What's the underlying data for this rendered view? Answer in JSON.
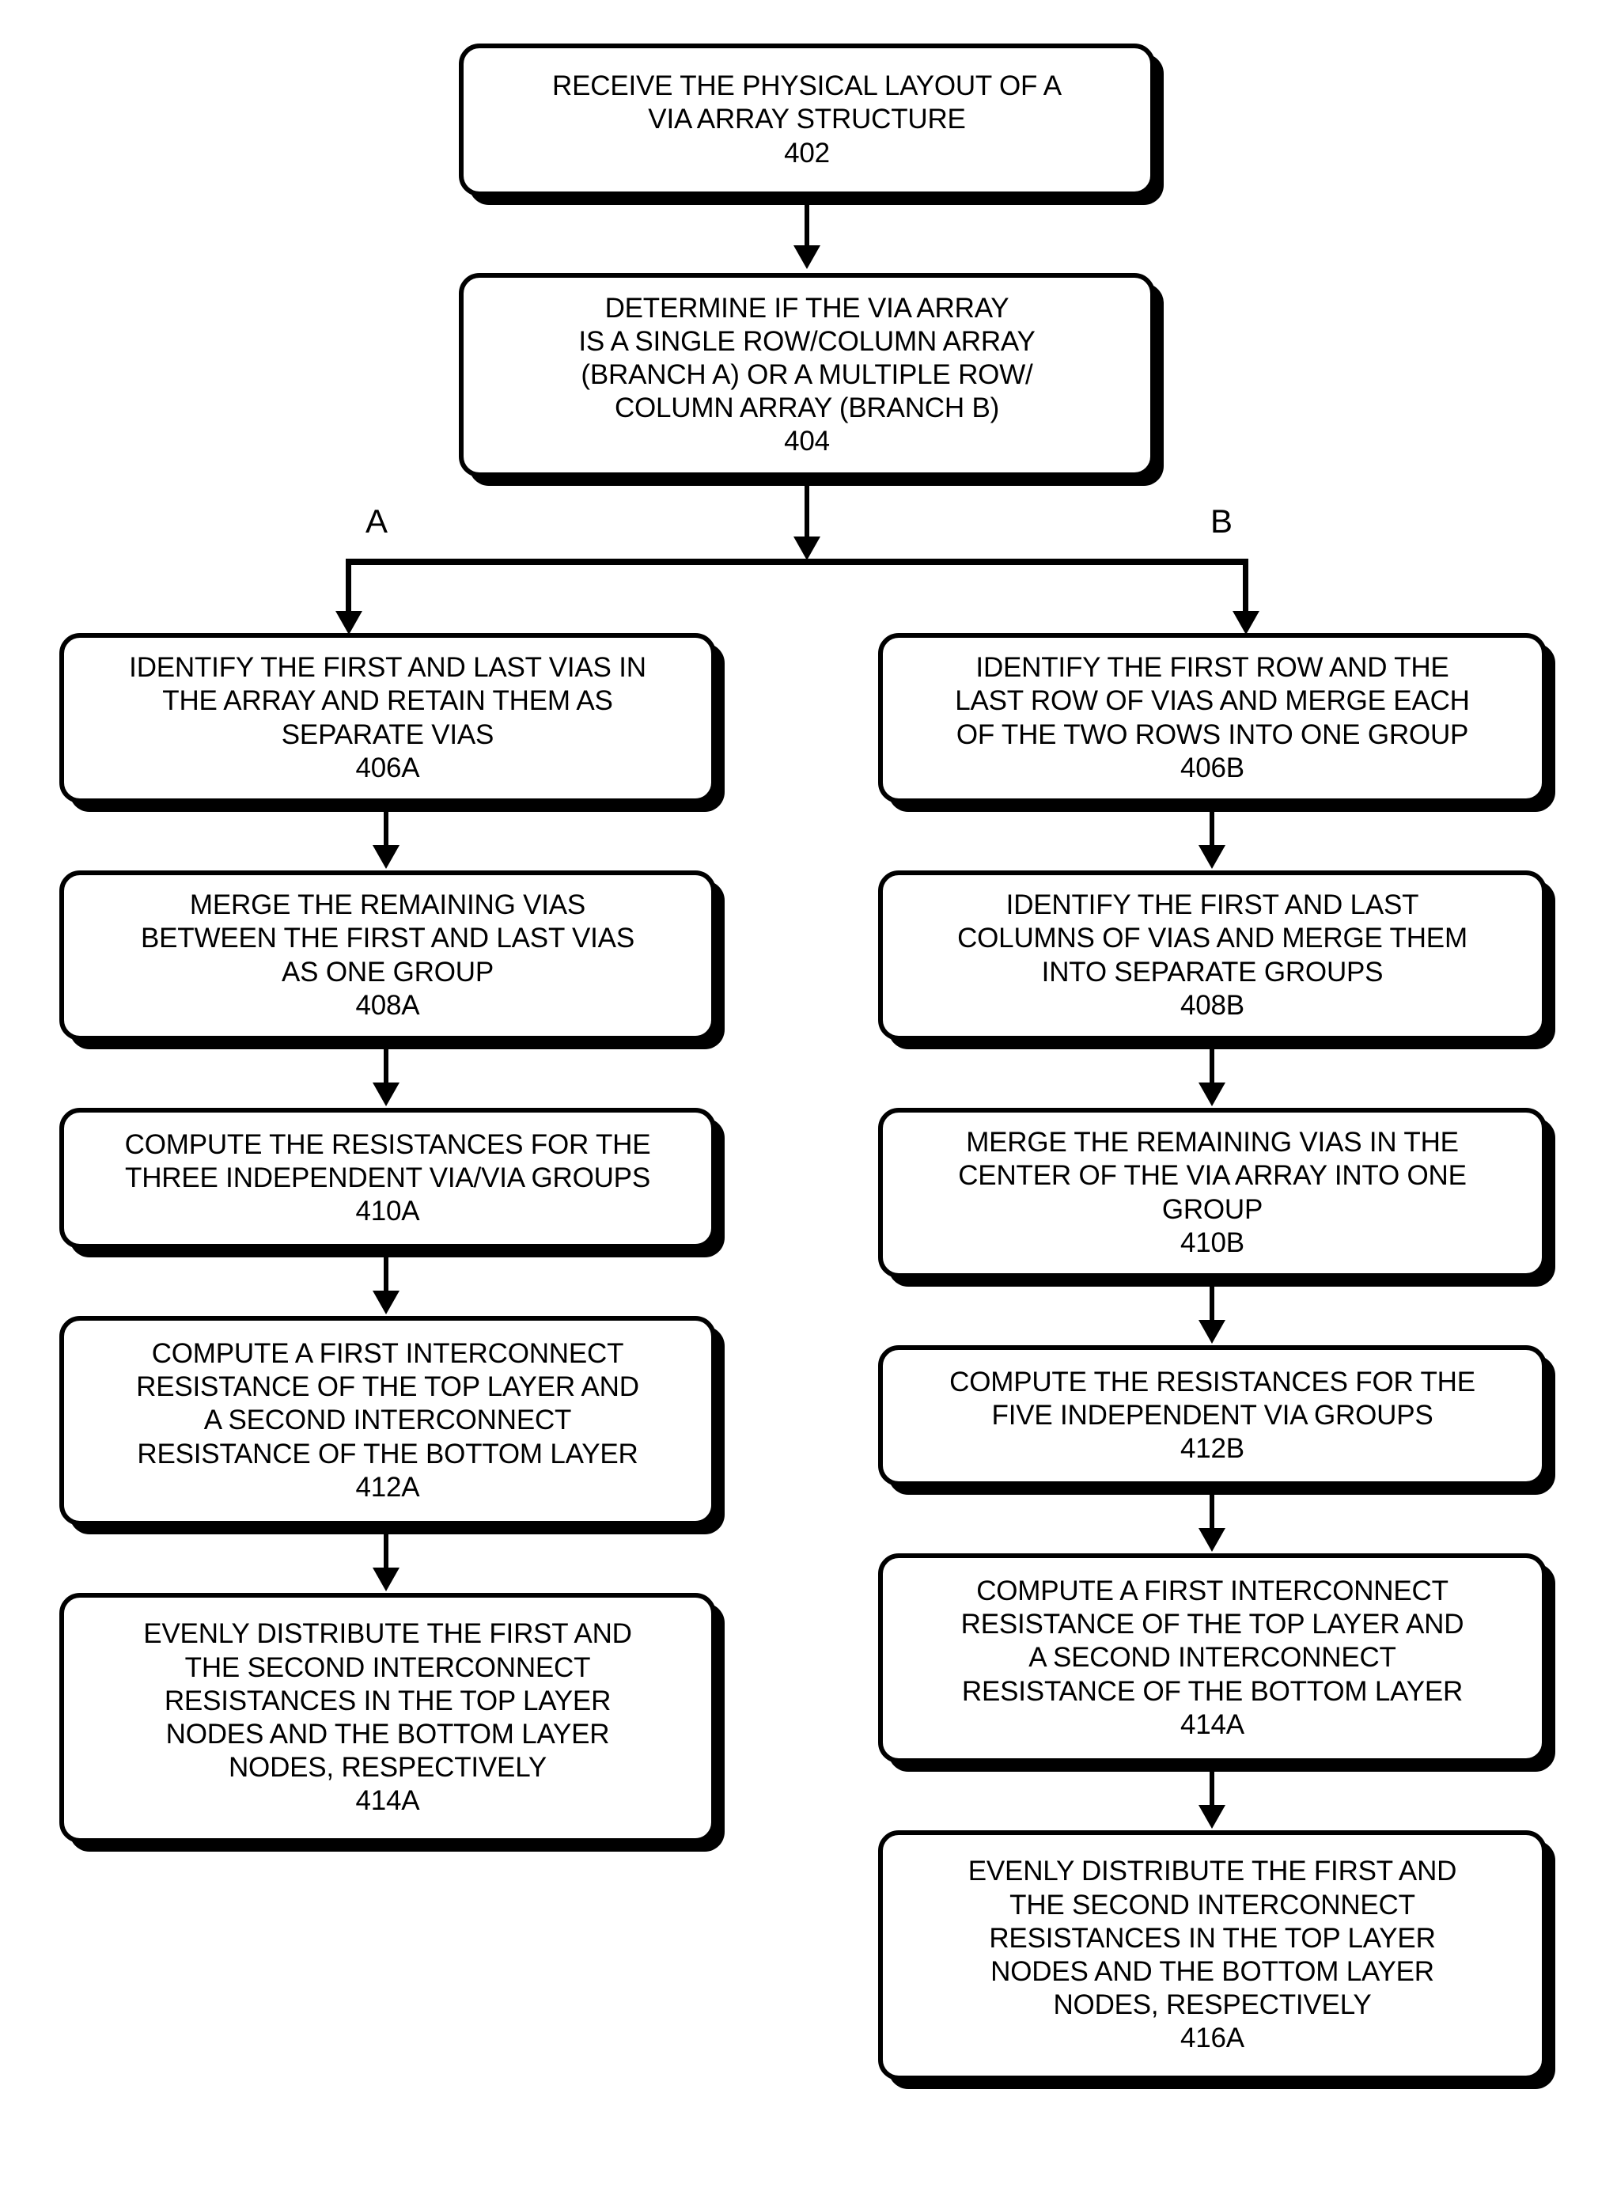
{
  "diagram": {
    "title": "Via array resistance extraction flowchart",
    "stroke_color": "#000000",
    "background_color": "#ffffff"
  },
  "nodes": {
    "n402": {
      "text": "RECEIVE THE PHYSICAL LAYOUT OF A\nVIA ARRAY STRUCTURE\n402",
      "ref": "402"
    },
    "n404": {
      "text": "DETERMINE IF THE VIA ARRAY\nIS A SINGLE ROW/COLUMN ARRAY\n(BRANCH A) OR A MULTIPLE ROW/\nCOLUMN ARRAY (BRANCH B)\n404",
      "ref": "404"
    },
    "n406a": {
      "text": "IDENTIFY THE FIRST AND LAST VIAS IN\nTHE ARRAY AND RETAIN THEM AS\nSEPARATE VIAS\n406A",
      "ref": "406A"
    },
    "n408a": {
      "text": "MERGE THE REMAINING VIAS\nBETWEEN THE FIRST AND LAST VIAS\nAS ONE GROUP\n408A",
      "ref": "408A"
    },
    "n410a": {
      "text": "COMPUTE THE RESISTANCES FOR THE\nTHREE INDEPENDENT VIA/VIA GROUPS\n410A",
      "ref": "410A"
    },
    "n412a": {
      "text": "COMPUTE A FIRST INTERCONNECT\nRESISTANCE OF THE TOP LAYER AND\nA SECOND INTERCONNECT\nRESISTANCE OF THE BOTTOM LAYER\n412A",
      "ref": "412A"
    },
    "n414a": {
      "text": "EVENLY DISTRIBUTE THE FIRST AND\nTHE SECOND INTERCONNECT\nRESISTANCES IN THE TOP LAYER\nNODES AND THE BOTTOM LAYER\nNODES, RESPECTIVELY\n414A",
      "ref": "414A"
    },
    "n406b": {
      "text": "IDENTIFY THE FIRST ROW AND THE\nLAST ROW OF VIAS AND MERGE EACH\nOF THE TWO ROWS INTO ONE GROUP\n406B",
      "ref": "406B"
    },
    "n408b": {
      "text": "IDENTIFY THE FIRST AND LAST\nCOLUMNS OF VIAS AND MERGE THEM\nINTO SEPARATE GROUPS\n408B",
      "ref": "408B"
    },
    "n410b": {
      "text": "MERGE THE REMAINING VIAS IN THE\nCENTER OF THE VIA ARRAY INTO ONE\nGROUP\n410B",
      "ref": "410B"
    },
    "n412b": {
      "text": "COMPUTE THE RESISTANCES FOR THE\nFIVE INDEPENDENT VIA GROUPS\n412B",
      "ref": "412B"
    },
    "n414b": {
      "text": "COMPUTE A FIRST INTERCONNECT\nRESISTANCE OF THE TOP LAYER AND\nA SECOND INTERCONNECT\nRESISTANCE OF THE BOTTOM LAYER\n414A",
      "ref": "414A"
    },
    "n416b": {
      "text": "EVENLY DISTRIBUTE THE FIRST AND\nTHE SECOND INTERCONNECT\nRESISTANCES IN THE TOP LAYER\nNODES AND THE BOTTOM LAYER\nNODES, RESPECTIVELY\n416A",
      "ref": "416A"
    }
  },
  "branches": {
    "left_label": "A",
    "right_label": "B"
  }
}
